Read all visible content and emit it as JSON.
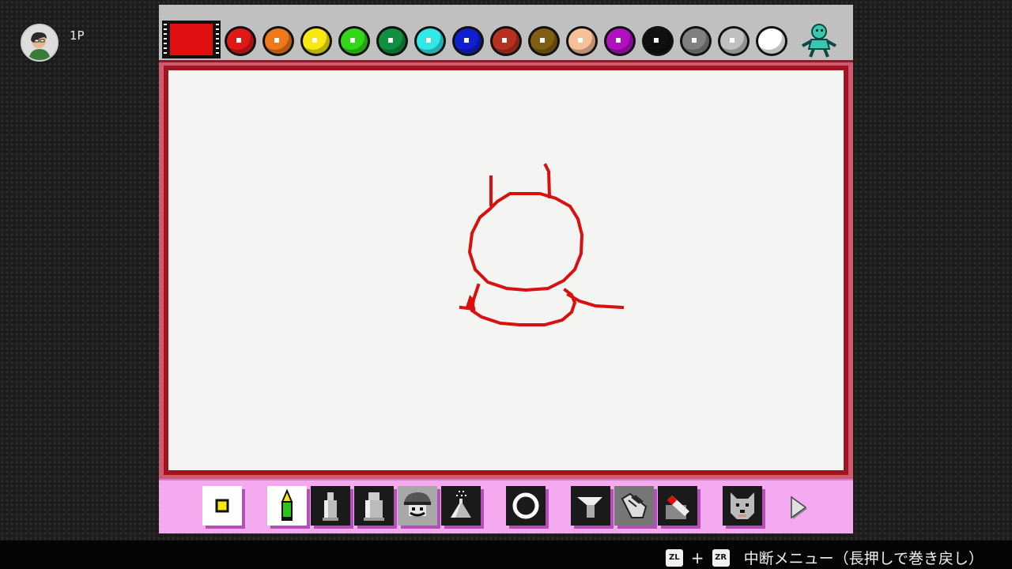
{
  "player": {
    "label": "1P",
    "icon": "player-avatar-icon"
  },
  "palette": {
    "current_color": "#e01010",
    "colors": [
      {
        "name": "red",
        "hex": "#e01818"
      },
      {
        "name": "orange",
        "hex": "#f07818"
      },
      {
        "name": "yellow",
        "hex": "#f8e810"
      },
      {
        "name": "green",
        "hex": "#30d818"
      },
      {
        "name": "dark-green",
        "hex": "#109040"
      },
      {
        "name": "cyan",
        "hex": "#30e8e8"
      },
      {
        "name": "blue",
        "hex": "#1020d0"
      },
      {
        "name": "brown-red",
        "hex": "#b83020"
      },
      {
        "name": "olive",
        "hex": "#806010"
      },
      {
        "name": "peach",
        "hex": "#f8c098"
      },
      {
        "name": "purple",
        "hex": "#b010c0"
      },
      {
        "name": "black",
        "hex": "#101010"
      },
      {
        "name": "gray",
        "hex": "#808080"
      },
      {
        "name": "light-gray",
        "hex": "#c0c0c0"
      },
      {
        "name": "white",
        "hex": "#ffffff"
      }
    ],
    "mascot_icon": "mascot-icon"
  },
  "canvas": {
    "stroke_color": "#d81010"
  },
  "tools": [
    {
      "name": "brush-size",
      "icon": "brush-size-icon"
    },
    {
      "name": "pencil",
      "icon": "pencil-icon"
    },
    {
      "name": "marker-small",
      "icon": "marker-icon"
    },
    {
      "name": "marker-large",
      "icon": "marker-large-icon"
    },
    {
      "name": "stamp",
      "icon": "stamp-icon"
    },
    {
      "name": "spray",
      "icon": "spray-icon"
    },
    {
      "name": "shape",
      "icon": "circle-shape-icon"
    },
    {
      "name": "fill",
      "icon": "fill-bucket-icon"
    },
    {
      "name": "hand",
      "icon": "hand-icon"
    },
    {
      "name": "eraser",
      "icon": "eraser-icon"
    },
    {
      "name": "dog",
      "icon": "dog-icon"
    },
    {
      "name": "next",
      "icon": "next-arrow-icon"
    }
  ],
  "hint": {
    "key1": "ZL",
    "plus": "+",
    "key2": "ZR",
    "text": "中断メニュー（長押しで巻き戻し）"
  }
}
